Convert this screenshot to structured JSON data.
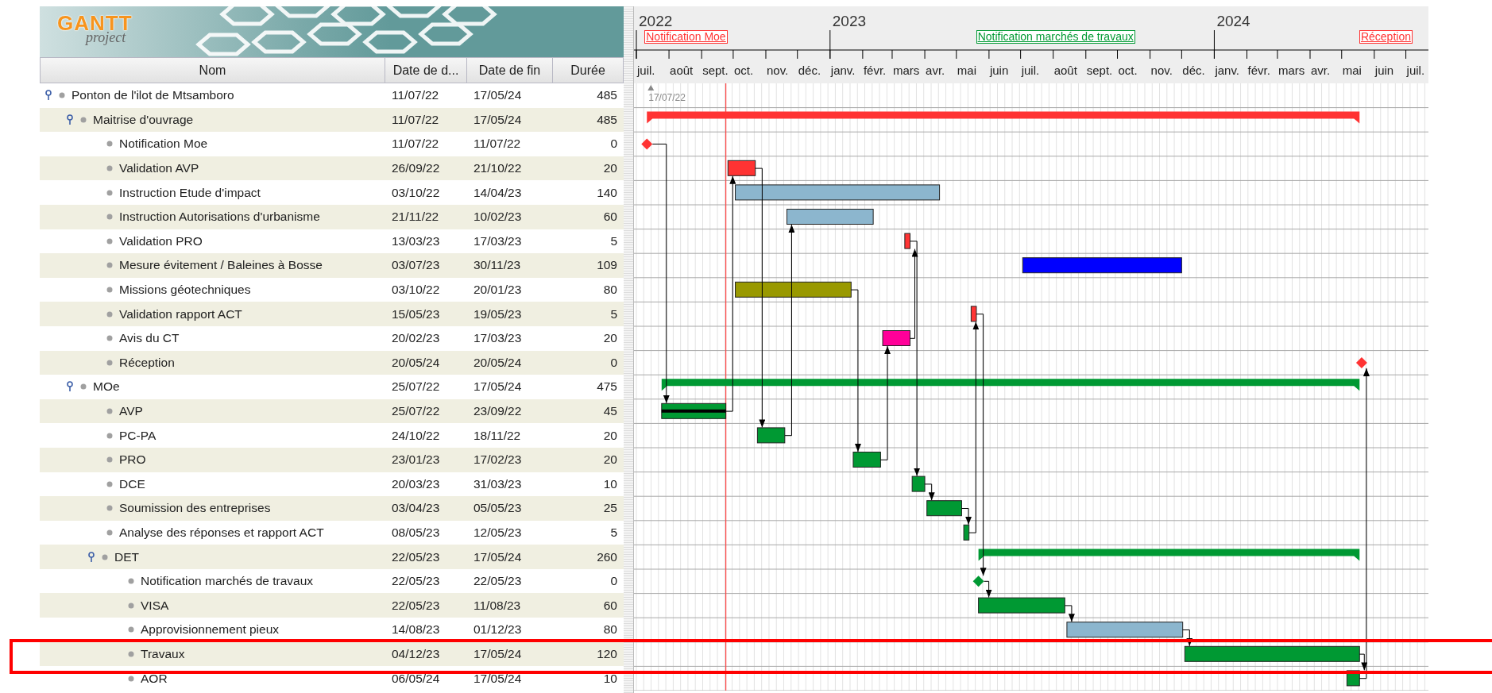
{
  "logo": {
    "title": "GANTT",
    "subtitle": "project"
  },
  "table": {
    "columns": [
      "Nom",
      "Date de d...",
      "Date de fin",
      "Durée"
    ]
  },
  "timeline": {
    "years": [
      "2022",
      "2023",
      "2024"
    ],
    "months": [
      "juil.",
      "août",
      "sept.",
      "oct.",
      "nov.",
      "déc.",
      "janv.",
      "févr.",
      "mars",
      "avr.",
      "mai",
      "juin",
      "juil.",
      "août",
      "sept.",
      "oct.",
      "nov.",
      "déc.",
      "janv.",
      "févr.",
      "mars",
      "avr.",
      "mai",
      "juin",
      "juil."
    ]
  },
  "project_start_label": "17/07/22",
  "tasks": [
    {
      "name": "Ponton de l'ilot de Mtsamboro",
      "start": "11/07/22",
      "end": "17/05/24",
      "duration": "485",
      "kind": "summary",
      "expanded": true,
      "highlighted": false,
      "children": [
        {
          "name": "Maitrise d'ouvrage",
          "start": "11/07/22",
          "end": "17/05/24",
          "duration": "485",
          "kind": "summary",
          "color": "#ff3333",
          "expanded": true,
          "highlighted": false,
          "children": [
            {
              "name": "Notification Moe",
              "start": "11/07/22",
              "end": "11/07/22",
              "duration": "0",
              "kind": "milestone",
              "color": "#ff3333",
              "header_label": "Notification Moe",
              "highlighted": false
            },
            {
              "name": "Validation AVP",
              "start": "26/09/22",
              "end": "21/10/22",
              "duration": "20",
              "kind": "task",
              "color": "#ff3333",
              "highlighted": false
            },
            {
              "name": "Instruction Etude d'impact",
              "start": "03/10/22",
              "end": "14/04/23",
              "duration": "140",
              "kind": "task",
              "color": "#8cb6ce",
              "highlighted": false
            },
            {
              "name": "Instruction Autorisations d'urbanisme",
              "start": "21/11/22",
              "end": "10/02/23",
              "duration": "60",
              "kind": "task",
              "color": "#8cb6ce",
              "highlighted": false
            },
            {
              "name": "Validation PRO",
              "start": "13/03/23",
              "end": "17/03/23",
              "duration": "5",
              "kind": "task",
              "color": "#ff3333",
              "highlighted": false
            },
            {
              "name": "Mesure évitement / Baleines à Bosse",
              "start": "03/07/23",
              "end": "30/11/23",
              "duration": "109",
              "kind": "task",
              "color": "#0000ff",
              "highlighted": false
            },
            {
              "name": "Missions géotechniques",
              "start": "03/10/22",
              "end": "20/01/23",
              "duration": "80",
              "kind": "task",
              "color": "#999900",
              "highlighted": false
            },
            {
              "name": "Validation rapport ACT",
              "start": "15/05/23",
              "end": "19/05/23",
              "duration": "5",
              "kind": "task",
              "color": "#ff3333",
              "highlighted": false
            },
            {
              "name": "Avis du CT",
              "start": "20/02/23",
              "end": "17/03/23",
              "duration": "20",
              "kind": "task",
              "color": "#ff0099",
              "highlighted": false
            },
            {
              "name": "Réception",
              "start": "20/05/24",
              "end": "20/05/24",
              "duration": "0",
              "kind": "milestone",
              "color": "#ff3333",
              "header_label": "Réception",
              "highlighted": false
            }
          ]
        },
        {
          "name": "MOe",
          "start": "25/07/22",
          "end": "17/05/24",
          "duration": "475",
          "kind": "summary",
          "color": "#009933",
          "expanded": true,
          "highlighted": false,
          "children": [
            {
              "name": "AVP",
              "start": "25/07/22",
              "end": "23/09/22",
              "duration": "45",
              "kind": "task",
              "color": "#009933",
              "level": 1,
              "highlighted": false
            },
            {
              "name": "PC-PA",
              "start": "24/10/22",
              "end": "18/11/22",
              "duration": "20",
              "kind": "task",
              "color": "#009933",
              "highlighted": false
            },
            {
              "name": "PRO",
              "start": "23/01/23",
              "end": "17/02/23",
              "duration": "20",
              "kind": "task",
              "color": "#009933",
              "highlighted": false
            },
            {
              "name": "DCE",
              "start": "20/03/23",
              "end": "31/03/23",
              "duration": "10",
              "kind": "task",
              "color": "#009933",
              "highlighted": false
            },
            {
              "name": "Soumission des entreprises",
              "start": "03/04/23",
              "end": "05/05/23",
              "duration": "25",
              "kind": "task",
              "color": "#009933",
              "highlighted": false
            },
            {
              "name": "Analyse des réponses et rapport ACT",
              "start": "08/05/23",
              "end": "12/05/23",
              "duration": "5",
              "kind": "task",
              "color": "#009933",
              "highlighted": false
            },
            {
              "name": "DET",
              "start": "22/05/23",
              "end": "17/05/24",
              "duration": "260",
              "kind": "summary",
              "color": "#009933",
              "expanded": true,
              "highlighted": false,
              "children": [
                {
                  "name": "Notification marchés de travaux",
                  "start": "22/05/23",
                  "end": "22/05/23",
                  "duration": "0",
                  "kind": "milestone",
                  "color": "#009933",
                  "header_label": "Notification marchés de travaux",
                  "highlighted": false
                },
                {
                  "name": "VISA",
                  "start": "22/05/23",
                  "end": "11/08/23",
                  "duration": "60",
                  "kind": "task",
                  "color": "#009933",
                  "highlighted": false
                },
                {
                  "name": "Approvisionnement pieux",
                  "start": "14/08/23",
                  "end": "01/12/23",
                  "duration": "80",
                  "kind": "task",
                  "color": "#8cb6ce",
                  "highlighted": false
                },
                {
                  "name": "Travaux",
                  "start": "04/12/23",
                  "end": "17/05/24",
                  "duration": "120",
                  "kind": "task",
                  "color": "#009933",
                  "highlighted": true
                },
                {
                  "name": "AOR",
                  "start": "06/05/24",
                  "end": "17/05/24",
                  "duration": "10",
                  "kind": "task",
                  "color": "#009933",
                  "highlighted": false
                }
              ]
            }
          ]
        }
      ]
    }
  ]
}
